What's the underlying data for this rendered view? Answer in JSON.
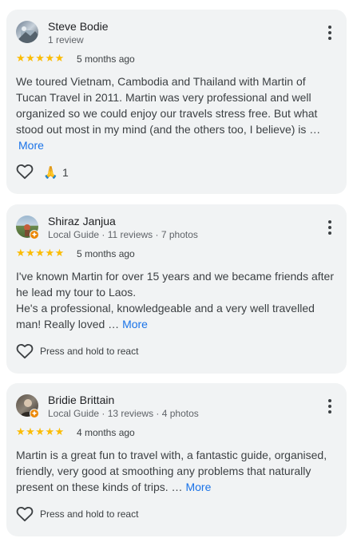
{
  "reviews": [
    {
      "name": "Steve Bodie",
      "meta": "1 review",
      "stars": "★★★★★",
      "date": "5 months ago",
      "text": "We toured Vietnam, Cambodia and Thailand with Martin of Tucan Travel in 2011. Martin was very professional and well organized so we could enjoy our travels stress free. But what stood out most in my mind (and the others too, I believe) is …",
      "more": "More",
      "reaction_emoji": "🙏",
      "reaction_count": "1"
    },
    {
      "name": "Shiraz Janjua",
      "meta": "Local Guide · 11 reviews · 7 photos",
      "stars": "★★★★★",
      "date": "5 months ago",
      "text_line1": "I've known Martin for over 15 years and we became friends after he lead my tour to Laos.",
      "text_line2": "He's a professional, knowledgeable and a very well travelled man! Really loved …",
      "more": "More",
      "react_label": "Press and hold to react"
    },
    {
      "name": "Bridie Brittain",
      "meta": "Local Guide · 13 reviews · 4 photos",
      "stars": "★★★★★",
      "date": "4 months ago",
      "text": "Martin is a great fun to travel with, a fantastic guide, organised, friendly, very good at smoothing any problems that naturally present on these kinds of trips. …",
      "more": "More",
      "react_label": "Press and hold to react"
    }
  ],
  "colors": {
    "card_bg": "#f1f3f4",
    "star": "#fbbc04",
    "link": "#1a73e8",
    "local_guide_badge": "#ea8600"
  },
  "icons": [
    "more-vert-icon",
    "heart-outline-icon",
    "star-icon",
    "local-guide-badge-icon"
  ]
}
